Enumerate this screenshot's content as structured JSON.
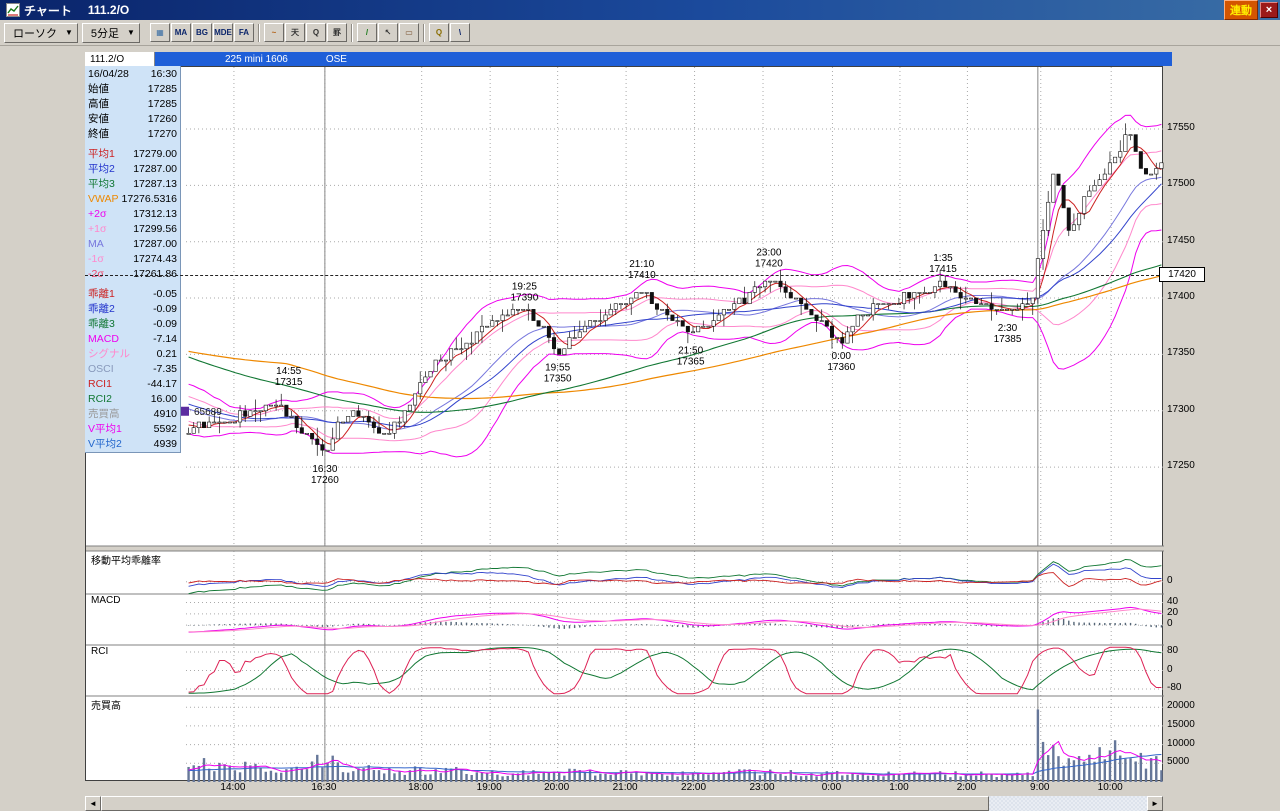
{
  "window": {
    "title": "チャート",
    "symbol": "111.2/O",
    "link_button": "連動",
    "close_glyph": "×"
  },
  "icons": {
    "dropdown_arrow": "▼",
    "scroll_left": "◄",
    "scroll_right": "►"
  },
  "toolbar": {
    "chart_type_dropdown": "ローソク",
    "interval_dropdown": "5分足",
    "buttons": [
      {
        "name": "chart-pane-button",
        "glyph": "▦",
        "color": "#3a6ea5"
      },
      {
        "name": "ma-indicator-button",
        "glyph": "MA",
        "color": "#0a246a"
      },
      {
        "name": "bg-indicator-button",
        "glyph": "BG",
        "color": "#0a246a"
      },
      {
        "name": "mde-indicator-button",
        "glyph": "MDE",
        "color": "#0a246a"
      },
      {
        "name": "fa-indicator-button",
        "glyph": "FA",
        "color": "#0a246a"
      },
      {
        "name": "line-chart-button",
        "glyph": "~",
        "color": "#b5651d",
        "sep": true
      },
      {
        "name": "scale-button",
        "glyph": "天",
        "color": "#333333"
      },
      {
        "name": "search-button",
        "glyph": "Q",
        "color": "#333333"
      },
      {
        "name": "grid-settings-button",
        "glyph": "罫",
        "color": "#333333"
      },
      {
        "name": "draw-line-button",
        "glyph": "/",
        "color": "#1a7a1a",
        "sep": true
      },
      {
        "name": "pointer-button",
        "glyph": "↖",
        "color": "#333333"
      },
      {
        "name": "eraser-button",
        "glyph": "▭",
        "color": "#7a5230"
      },
      {
        "name": "zoom-in-button",
        "glyph": "Q",
        "color": "#8a6d00",
        "sep": true
      },
      {
        "name": "trendline-button",
        "glyph": "\\",
        "color": "#0a246a"
      }
    ]
  },
  "info_bar": {
    "tab": "111.2/O",
    "contract": "225 mini 1606",
    "exchange": "OSE"
  },
  "quote_panel": {
    "rows": [
      {
        "label": "16/04/28",
        "value": "16:30",
        "color": "#000000"
      },
      {
        "label": "始値",
        "value": "17285",
        "color": "#000000"
      },
      {
        "label": "高値",
        "value": "17285",
        "color": "#000000"
      },
      {
        "label": "安値",
        "value": "17260",
        "color": "#000000"
      },
      {
        "label": "終値",
        "value": "17270",
        "color": "#000000"
      },
      {
        "label": "平均1",
        "value": "17279.00",
        "color": "#cc2222",
        "gap": true
      },
      {
        "label": "平均2",
        "value": "17287.00",
        "color": "#2233cc"
      },
      {
        "label": "平均3",
        "value": "17287.13",
        "color": "#117733"
      },
      {
        "label": "VWAP",
        "value": "17276.5316",
        "color": "#ee8800"
      },
      {
        "label": "+2σ",
        "value": "17312.13",
        "color": "#ee00ee"
      },
      {
        "label": "+1σ",
        "value": "17299.56",
        "color": "#ff88cc"
      },
      {
        "label": "MA",
        "value": "17287.00",
        "color": "#7777dd"
      },
      {
        "label": "-1σ",
        "value": "17274.43",
        "color": "#ff88cc"
      },
      {
        "label": "-2σ",
        "value": "17261.86",
        "color": "#ee4466"
      },
      {
        "label": "乖離1",
        "value": "-0.05",
        "color": "#cc2222",
        "gap": true
      },
      {
        "label": "乖離2",
        "value": "-0.09",
        "color": "#2233cc"
      },
      {
        "label": "乖離3",
        "value": "-0.09",
        "color": "#117733"
      },
      {
        "label": "MACD",
        "value": "-7.14",
        "color": "#ee00ee"
      },
      {
        "label": "シグナル",
        "value": "0.21",
        "color": "#ff88cc"
      },
      {
        "label": "OSCI",
        "value": "-7.35",
        "color": "#8899bb"
      },
      {
        "label": "RCI1",
        "value": "-44.17",
        "color": "#cc2222"
      },
      {
        "label": "RCI2",
        "value": "16.00",
        "color": "#117733"
      },
      {
        "label": "売買高",
        "value": "4910",
        "color": "#999999"
      },
      {
        "label": "V平均1",
        "value": "5592",
        "color": "#ee00ee"
      },
      {
        "label": "V平均2",
        "value": "4939",
        "color": "#2266cc"
      }
    ]
  },
  "chart_data": {
    "type": "candlestick",
    "instrument": "225 mini 1606",
    "exchange": "OSE",
    "interval": "5分足",
    "candle_count": 190,
    "price_range": [
      17180,
      17605
    ],
    "price_axis_ticks": [
      17550,
      17500,
      17450,
      17400,
      17350,
      17300,
      17250
    ],
    "current_price": 17420,
    "volume_marker": {
      "text": "65689",
      "price": 17300
    },
    "time_ticks": [
      {
        "label": "14:00",
        "xf": 0.049
      },
      {
        "label": "16:30",
        "xf": 0.142
      },
      {
        "label": "18:00",
        "xf": 0.241
      },
      {
        "label": "19:00",
        "xf": 0.311
      },
      {
        "label": "20:00",
        "xf": 0.38
      },
      {
        "label": "21:00",
        "xf": 0.45
      },
      {
        "label": "22:00",
        "xf": 0.52
      },
      {
        "label": "23:00",
        "xf": 0.59
      },
      {
        "label": "0:00",
        "xf": 0.661
      },
      {
        "label": "1:00",
        "xf": 0.73
      },
      {
        "label": "2:00",
        "xf": 0.799
      },
      {
        "label": "9:00",
        "xf": 0.874
      },
      {
        "label": "10:00",
        "xf": 0.946
      }
    ],
    "solid_vlines": [
      0.142,
      0.871
    ],
    "annotations": [
      {
        "time": "14:55",
        "price": "17315",
        "p": 17315,
        "xf": 0.105,
        "dir": "above"
      },
      {
        "time": "16:30",
        "price": "17260",
        "p": 17260,
        "xf": 0.142,
        "dir": "below"
      },
      {
        "time": "19:25",
        "price": "17390",
        "p": 17390,
        "xf": 0.346,
        "dir": "above"
      },
      {
        "time": "19:55",
        "price": "17350",
        "p": 17350,
        "xf": 0.38,
        "dir": "below"
      },
      {
        "time": "21:10",
        "price": "17410",
        "p": 17410,
        "xf": 0.466,
        "dir": "above"
      },
      {
        "time": "21:50",
        "price": "17365",
        "p": 17365,
        "xf": 0.516,
        "dir": "below"
      },
      {
        "time": "23:00",
        "price": "17420",
        "p": 17420,
        "xf": 0.596,
        "dir": "above"
      },
      {
        "time": "0:00",
        "price": "17360",
        "p": 17360,
        "xf": 0.67,
        "dir": "below"
      },
      {
        "time": "1:35",
        "price": "17415",
        "p": 17415,
        "xf": 0.774,
        "dir": "above"
      },
      {
        "time": "2:30",
        "price": "17385",
        "p": 17385,
        "xf": 0.84,
        "dir": "below"
      }
    ],
    "close_anchors": [
      [
        0.0,
        17282
      ],
      [
        0.02,
        17290
      ],
      [
        0.04,
        17288
      ],
      [
        0.06,
        17298
      ],
      [
        0.08,
        17308
      ],
      [
        0.095,
        17300
      ],
      [
        0.11,
        17288
      ],
      [
        0.125,
        17275
      ],
      [
        0.142,
        17262
      ],
      [
        0.155,
        17288
      ],
      [
        0.17,
        17300
      ],
      [
        0.185,
        17292
      ],
      [
        0.2,
        17282
      ],
      [
        0.21,
        17287
      ],
      [
        0.225,
        17302
      ],
      [
        0.241,
        17330
      ],
      [
        0.255,
        17342
      ],
      [
        0.27,
        17352
      ],
      [
        0.285,
        17360
      ],
      [
        0.3,
        17372
      ],
      [
        0.32,
        17383
      ],
      [
        0.346,
        17390
      ],
      [
        0.362,
        17375
      ],
      [
        0.38,
        17352
      ],
      [
        0.395,
        17365
      ],
      [
        0.41,
        17377
      ],
      [
        0.43,
        17388
      ],
      [
        0.45,
        17395
      ],
      [
        0.466,
        17408
      ],
      [
        0.48,
        17392
      ],
      [
        0.5,
        17378
      ],
      [
        0.516,
        17366
      ],
      [
        0.535,
        17380
      ],
      [
        0.555,
        17392
      ],
      [
        0.575,
        17400
      ],
      [
        0.596,
        17417
      ],
      [
        0.615,
        17405
      ],
      [
        0.635,
        17392
      ],
      [
        0.655,
        17375
      ],
      [
        0.67,
        17362
      ],
      [
        0.69,
        17383
      ],
      [
        0.71,
        17394
      ],
      [
        0.73,
        17398
      ],
      [
        0.75,
        17404
      ],
      [
        0.774,
        17413
      ],
      [
        0.79,
        17405
      ],
      [
        0.81,
        17396
      ],
      [
        0.825,
        17390
      ],
      [
        0.84,
        17386
      ],
      [
        0.855,
        17393
      ],
      [
        0.868,
        17398
      ],
      [
        0.874,
        17440
      ],
      [
        0.882,
        17478
      ],
      [
        0.89,
        17512
      ],
      [
        0.898,
        17488
      ],
      [
        0.906,
        17458
      ],
      [
        0.914,
        17472
      ],
      [
        0.922,
        17492
      ],
      [
        0.93,
        17500
      ],
      [
        0.94,
        17508
      ],
      [
        0.95,
        17522
      ],
      [
        0.96,
        17538
      ],
      [
        0.968,
        17545
      ],
      [
        0.976,
        17520
      ],
      [
        0.985,
        17508
      ],
      [
        0.993,
        17515
      ],
      [
        1.0,
        17518
      ]
    ],
    "volume_anchors": [
      [
        0.0,
        5200
      ],
      [
        0.04,
        4200
      ],
      [
        0.09,
        3600
      ],
      [
        0.13,
        5200
      ],
      [
        0.142,
        6800
      ],
      [
        0.16,
        4200
      ],
      [
        0.2,
        2800
      ],
      [
        0.25,
        3200
      ],
      [
        0.3,
        2600
      ],
      [
        0.35,
        2400
      ],
      [
        0.4,
        2600
      ],
      [
        0.45,
        2400
      ],
      [
        0.5,
        2200
      ],
      [
        0.55,
        2400
      ],
      [
        0.6,
        2600
      ],
      [
        0.65,
        2200
      ],
      [
        0.7,
        2000
      ],
      [
        0.75,
        2200
      ],
      [
        0.8,
        2000
      ],
      [
        0.85,
        2200
      ],
      [
        0.868,
        2600
      ],
      [
        0.874,
        21000
      ],
      [
        0.88,
        9500
      ],
      [
        0.89,
        8000
      ],
      [
        0.9,
        6500
      ],
      [
        0.91,
        5500
      ],
      [
        0.925,
        6500
      ],
      [
        0.94,
        7500
      ],
      [
        0.955,
        8500
      ],
      [
        0.968,
        9000
      ],
      [
        0.98,
        6000
      ],
      [
        1.0,
        5200
      ]
    ],
    "subcharts": [
      {
        "key": "dev",
        "label": "移動平均乖離率",
        "range": [
          -0.4,
          1.0
        ],
        "axis_labels": [
          {
            "value": 0,
            "text": "0"
          }
        ]
      },
      {
        "key": "macd",
        "label": "MACD",
        "range": [
          -35,
          55
        ],
        "axis_labels": [
          {
            "value": 40,
            "text": "40"
          },
          {
            "value": 20,
            "text": "20"
          },
          {
            "value": 0,
            "text": "0"
          }
        ]
      },
      {
        "key": "rci",
        "label": "RCI",
        "range": [
          -110,
          110
        ],
        "axis_labels": [
          {
            "value": 80,
            "text": "80"
          },
          {
            "value": 0,
            "text": "0"
          },
          {
            "value": -80,
            "text": "-80"
          }
        ]
      },
      {
        "key": "vol",
        "label": "売買高",
        "range": [
          0,
          23000
        ],
        "axis_labels": [
          {
            "value": 20000,
            "text": "20000"
          },
          {
            "value": 15000,
            "text": "15000"
          },
          {
            "value": 10000,
            "text": "10000"
          },
          {
            "value": 5000,
            "text": "5000"
          }
        ]
      }
    ],
    "colors": {
      "up_candle": "#ffffff",
      "down_candle": "#111111",
      "wick": "#111111",
      "ma1": "#cc2222",
      "ma2": "#3344cc",
      "ma3": "#117733",
      "vwap": "#ee8800",
      "band2": "#ee00ee",
      "band1": "#ff88cc",
      "band_ma": "#7777dd",
      "macd": "#ee00ee",
      "signal": "#ff88cc",
      "hist": "#556677",
      "rci1": "#dd2255",
      "rci2": "#117733",
      "vol_bar": "#667799",
      "vma1": "#ee00ee",
      "vma2": "#3366cc",
      "grid": "#aaaaaa",
      "session_line": "#888888"
    }
  }
}
